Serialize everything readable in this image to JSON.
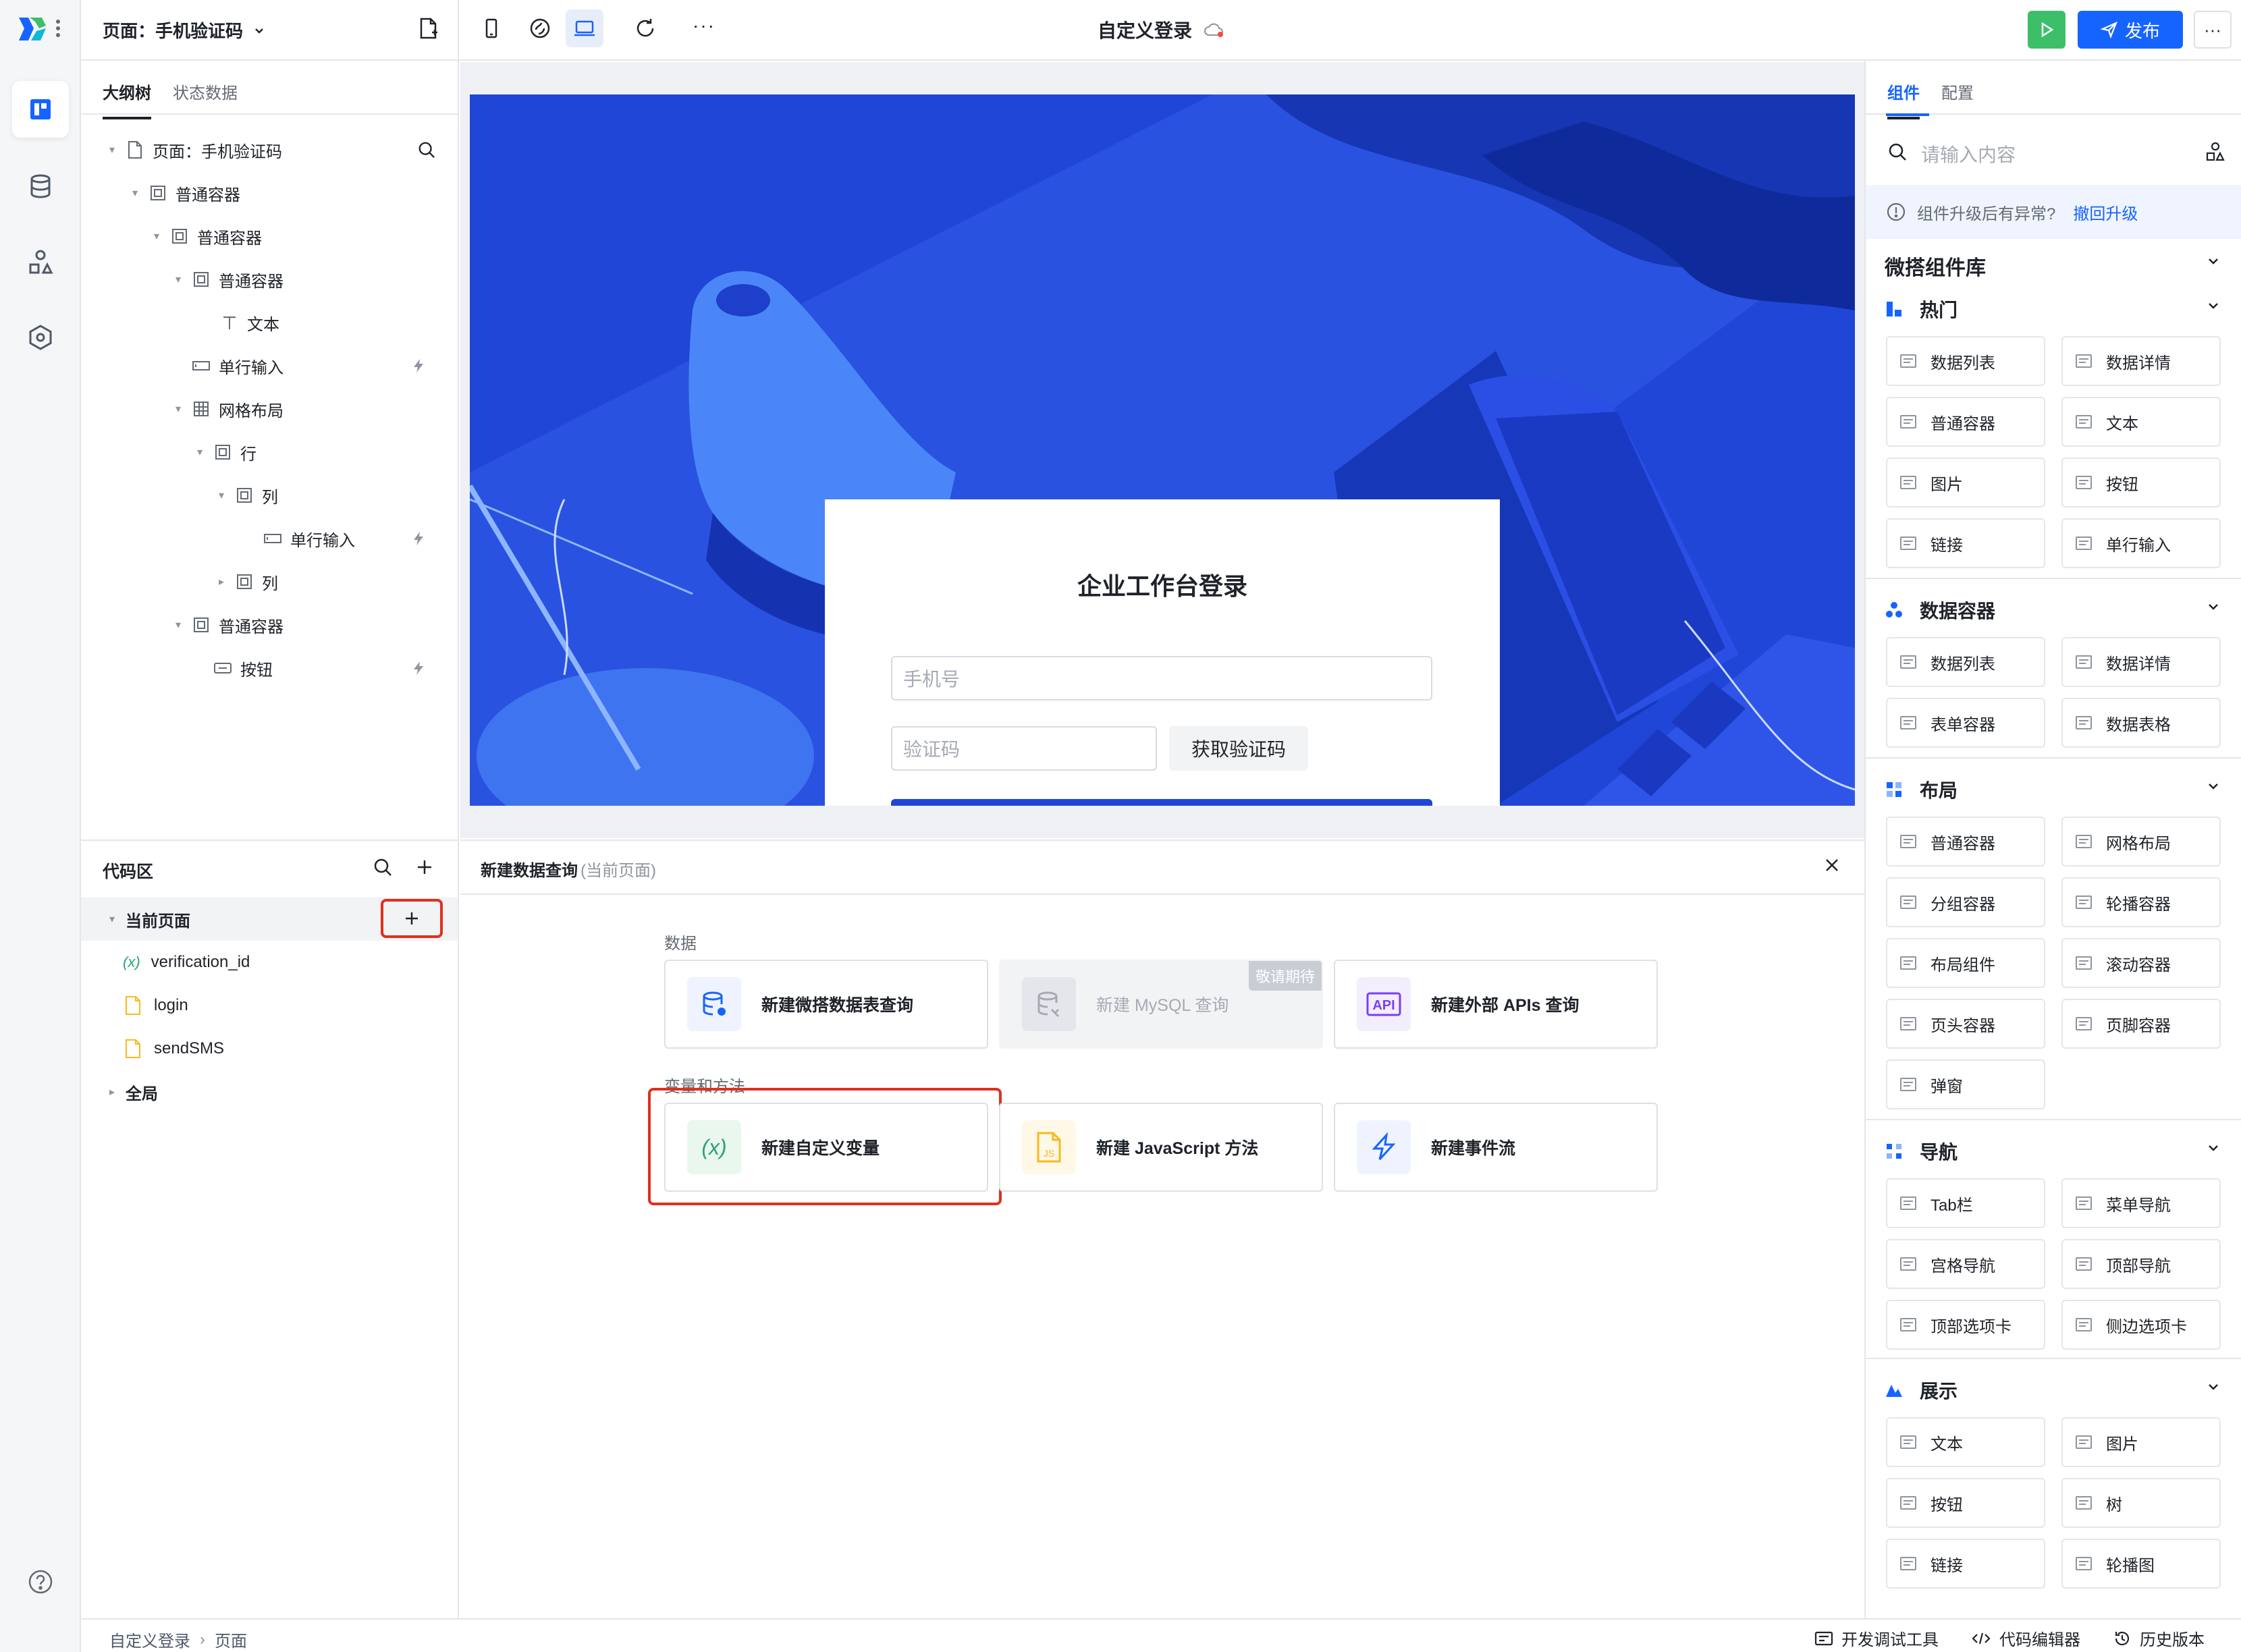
{
  "topbar": {
    "page_selector": "页面：手机验证码",
    "app_title": "自定义登录",
    "publish_label": "发布",
    "more_label": "···"
  },
  "leftpanel": {
    "tabs": [
      "大纲树",
      "状态数据"
    ],
    "tree": [
      {
        "label": "页面：手机验证码",
        "icon": "page-icon"
      },
      {
        "label": "普通容器",
        "icon": "container-icon"
      },
      {
        "label": "普通容器",
        "icon": "container-icon"
      },
      {
        "label": "普通容器",
        "icon": "container-icon"
      },
      {
        "label": "文本",
        "icon": "text-icon"
      },
      {
        "label": "单行输入",
        "icon": "input-icon"
      },
      {
        "label": "网格布局",
        "icon": "grid-icon"
      },
      {
        "label": "行",
        "icon": "container-icon"
      },
      {
        "label": "列",
        "icon": "container-icon"
      },
      {
        "label": "单行输入",
        "icon": "input-icon"
      },
      {
        "label": "列",
        "icon": "container-icon"
      },
      {
        "label": "普通容器",
        "icon": "container-icon"
      },
      {
        "label": "按钮",
        "icon": "button-icon"
      }
    ]
  },
  "codearea": {
    "title": "代码区",
    "current_page": "当前页面",
    "items": [
      "verification_id",
      "login",
      "sendSMS"
    ],
    "global": "全局"
  },
  "canvas": {
    "login_title": "企业工作台登录",
    "phone_placeholder": "手机号",
    "code_placeholder": "验证码",
    "get_code_button": "获取验证码"
  },
  "bottompanel": {
    "title": "新建数据查询",
    "scope": "(当前页面)",
    "data_section": "数据",
    "var_section": "变量和方法",
    "cards_data": [
      {
        "label": "新建微搭数据表查询",
        "icon": "database-icon"
      },
      {
        "label": "新建 MySQL 查询",
        "icon": "mysql-icon",
        "badge": "敬请期待",
        "disabled": true
      },
      {
        "label": "新建外部 APIs 查询",
        "icon": "api-icon"
      }
    ],
    "cards_var": [
      {
        "label": "新建自定义变量",
        "icon": "variable-icon"
      },
      {
        "label": "新建 JavaScript 方法",
        "icon": "javascript-icon"
      },
      {
        "label": "新建事件流",
        "icon": "event-flow-icon"
      }
    ]
  },
  "rightpanel": {
    "tabs": [
      "组件",
      "配置"
    ],
    "search_placeholder": "请输入内容",
    "notice": "组件升级后有异常?",
    "notice_link": "撤回升级",
    "library": "微搭组件库",
    "groups": [
      {
        "title": "热门",
        "items": [
          "数据列表",
          "数据详情",
          "普通容器",
          "文本",
          "图片",
          "按钮",
          "链接",
          "单行输入"
        ]
      },
      {
        "title": "数据容器",
        "items": [
          "数据列表",
          "数据详情",
          "表单容器",
          "数据表格"
        ]
      },
      {
        "title": "布局",
        "items": [
          "普通容器",
          "网格布局",
          "分组容器",
          "轮播容器",
          "布局组件",
          "滚动容器",
          "页头容器",
          "页脚容器",
          "弹窗"
        ]
      },
      {
        "title": "导航",
        "items": [
          "Tab栏",
          "菜单导航",
          "宫格导航",
          "顶部导航",
          "顶部选项卡",
          "侧边选项卡"
        ]
      },
      {
        "title": "展示",
        "items": [
          "文本",
          "图片",
          "按钮",
          "树",
          "链接",
          "轮播图"
        ]
      }
    ]
  },
  "statusbar": {
    "breadcrumb": [
      "自定义登录",
      "页面"
    ],
    "devtools": "开发调试工具",
    "code_editor": "代码编辑器",
    "history": "历史版本"
  },
  "colors": {
    "brand": "#1664ff",
    "run_green": "#3dbf6a",
    "highlight_red": "#e0301e",
    "hero_blue": "#1f46d6"
  }
}
